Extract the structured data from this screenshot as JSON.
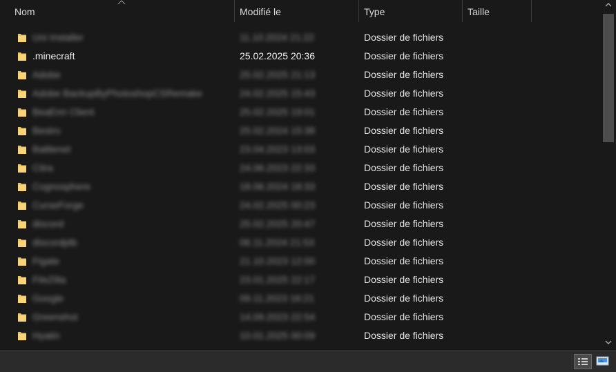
{
  "columns": {
    "name": "Nom",
    "modified": "Modifié le",
    "type": "Type",
    "size": "Taille"
  },
  "rows": [
    {
      "name": "Uni Installer",
      "date": "11.10.2024 21:22",
      "type": "Dossier de fichiers",
      "blurred": true
    },
    {
      "name": ".minecraft",
      "date": "25.02.2025 20:36",
      "type": "Dossier de fichiers",
      "blurred": false
    },
    {
      "name": "Adobe",
      "date": "25.02.2025 21:13",
      "type": "Dossier de fichiers",
      "blurred": true
    },
    {
      "name": "Adobe BackupByPhotoshopCSRemake",
      "date": "24.02.2025 15:43",
      "type": "Dossier de fichiers",
      "blurred": true
    },
    {
      "name": "BeaEnn Client",
      "date": "25.02.2025 19:01",
      "type": "Dossier de fichiers",
      "blurred": true
    },
    {
      "name": "Bestro",
      "date": "25.02.2024 15:38",
      "type": "Dossier de fichiers",
      "blurred": true
    },
    {
      "name": "Battlenet",
      "date": "23.04.2023 13:03",
      "type": "Dossier de fichiers",
      "blurred": true
    },
    {
      "name": "Citra",
      "date": "24.06.2023 22:33",
      "type": "Dossier de fichiers",
      "blurred": true
    },
    {
      "name": "Cognosphere",
      "date": "18.06.2024 18:33",
      "type": "Dossier de fichiers",
      "blurred": true
    },
    {
      "name": "CurseForge",
      "date": "24.02.2025 00:23",
      "type": "Dossier de fichiers",
      "blurred": true
    },
    {
      "name": "discord",
      "date": "25.02.2025 20:47",
      "type": "Dossier de fichiers",
      "blurred": true
    },
    {
      "name": "discordptb",
      "date": "06.11.2024 21:53",
      "type": "Dossier de fichiers",
      "blurred": true
    },
    {
      "name": "Figate",
      "date": "21.10.2023 12:00",
      "type": "Dossier de fichiers",
      "blurred": true
    },
    {
      "name": "FileZilla",
      "date": "23.01.2025 22:17",
      "type": "Dossier de fichiers",
      "blurred": true
    },
    {
      "name": "Google",
      "date": "09.11.2023 16:21",
      "type": "Dossier de fichiers",
      "blurred": true
    },
    {
      "name": "Greenshot",
      "date": "14.09.2023 22:54",
      "type": "Dossier de fichiers",
      "blurred": true
    },
    {
      "name": "Hyatin",
      "date": "10.01.2025 00:09",
      "type": "Dossier de fichiers",
      "blurred": true
    }
  ],
  "icons": {
    "folder": "folder-icon",
    "details_view": "details-view-icon",
    "tiles_view": "large-icons-view-icon"
  },
  "colors": {
    "background": "#191919",
    "folder": "#f2c55c",
    "statusbar": "#2b2b2b"
  }
}
